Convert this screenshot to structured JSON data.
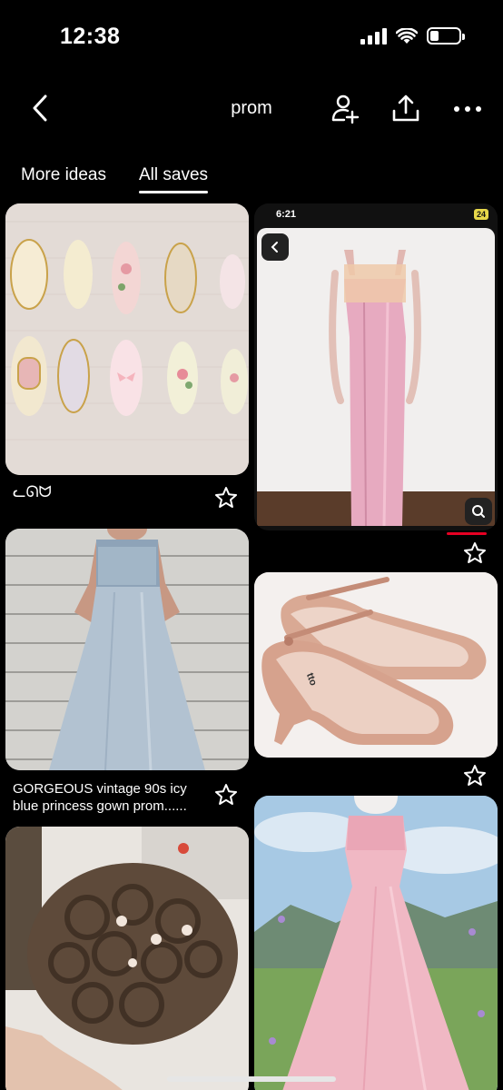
{
  "status_bar": {
    "time": "12:38"
  },
  "header": {
    "title": "prom"
  },
  "tabs": [
    {
      "label": "More ideas"
    },
    {
      "label": "All saves"
    }
  ],
  "pins": [
    {
      "subject": "press-on nails",
      "caption": "ᓚᘏᗢ"
    },
    {
      "subject": "pink satin dress",
      "inner_time": "6:21",
      "inner_battery": "24"
    },
    {
      "subject": "icy blue gown",
      "caption": "GORGEOUS vintage 90s icy blue princess gown prom......"
    },
    {
      "subject": "pink mary jane heels",
      "shoe_text": "tto"
    },
    {
      "subject": "curled updo hairstyle"
    },
    {
      "subject": "pink strapless gown"
    }
  ],
  "colors": {
    "background": "#000000",
    "text": "#ffffff",
    "accent_red": "#e60023"
  }
}
